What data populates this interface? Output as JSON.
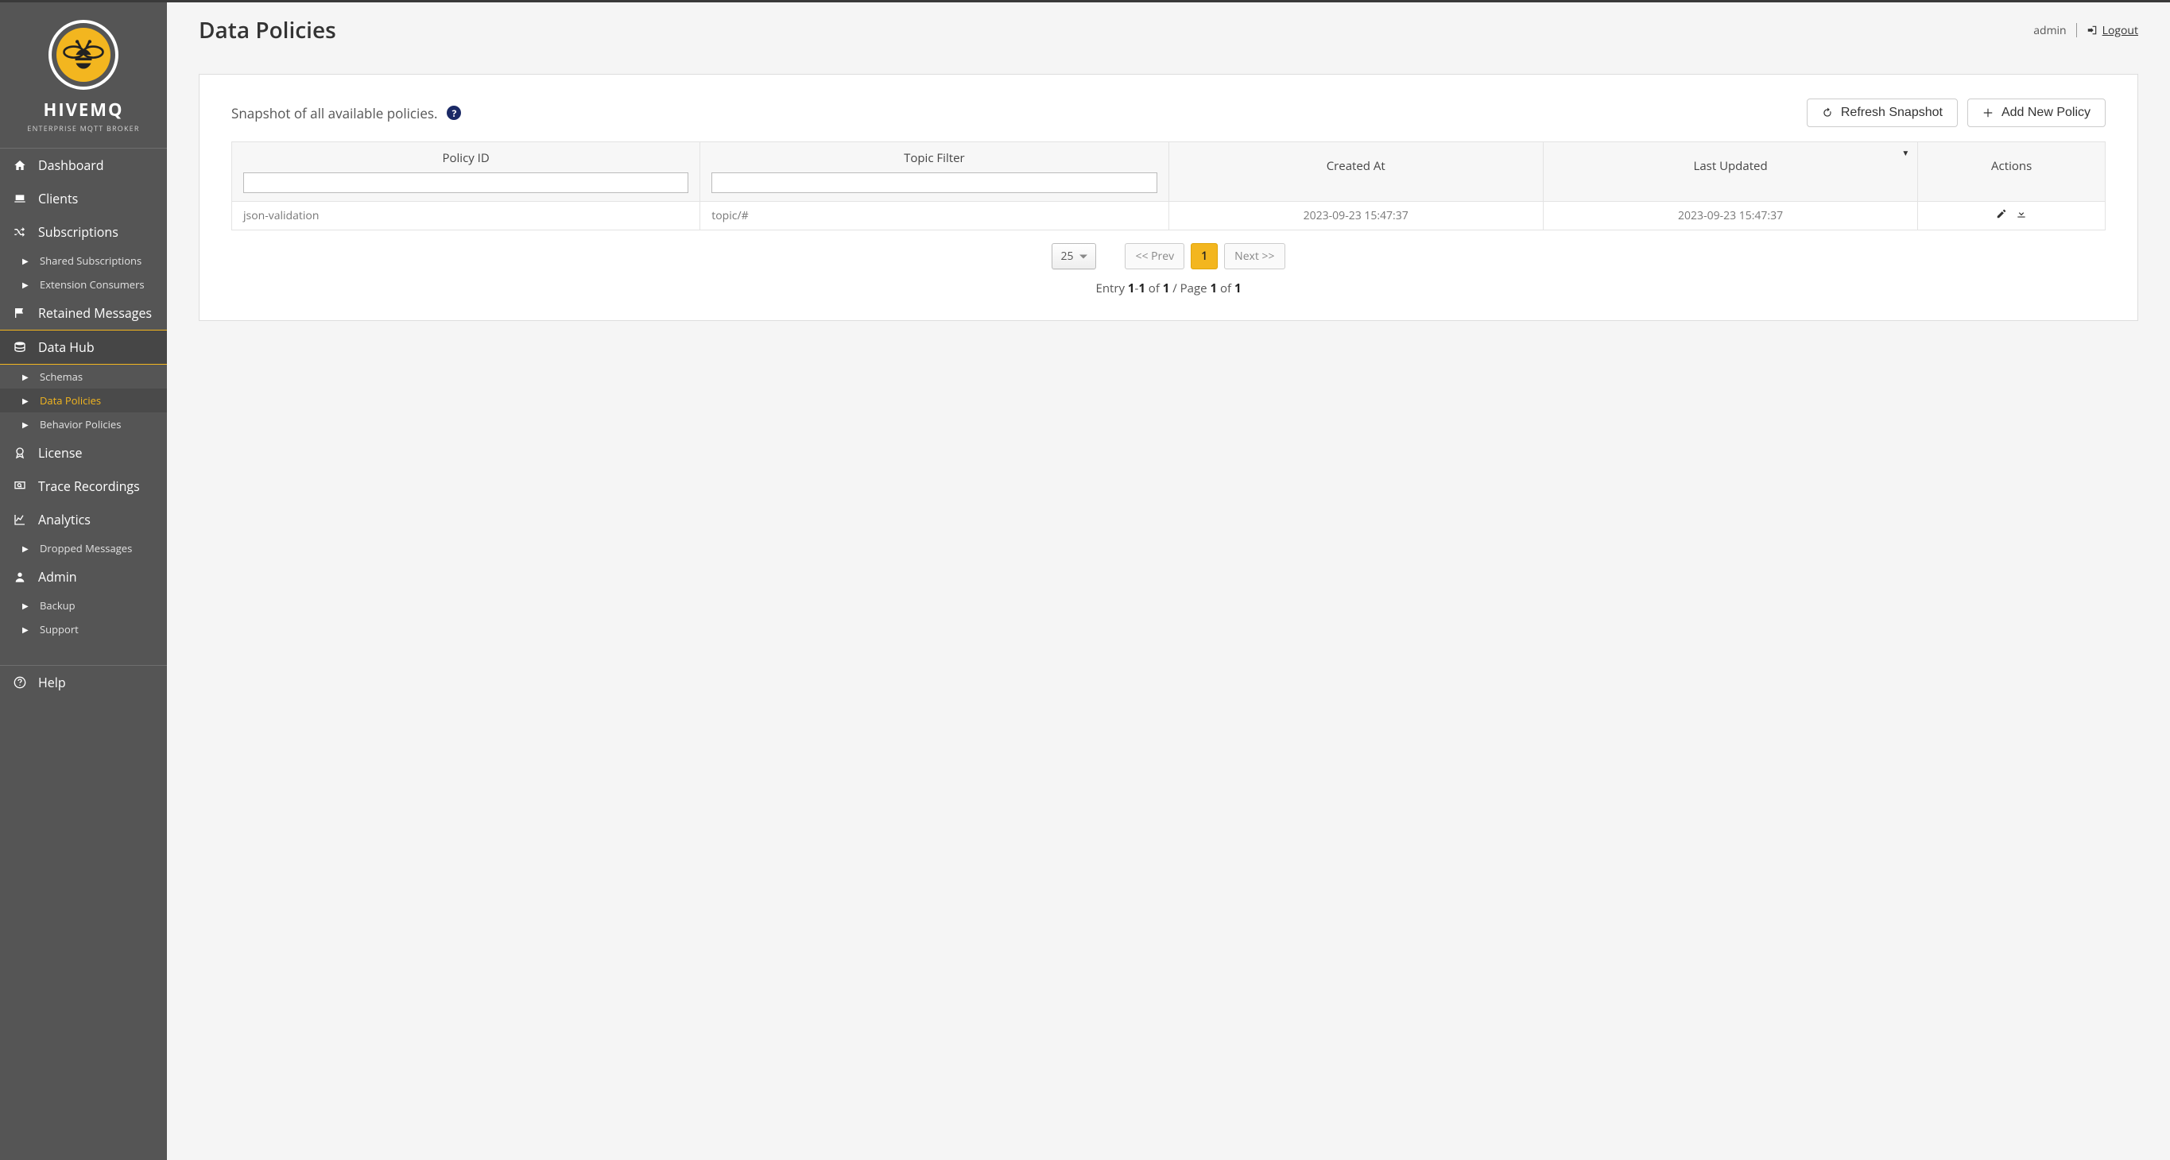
{
  "brand": {
    "name": "HIVEMQ",
    "subtitle": "ENTERPRISE MQTT BROKER"
  },
  "sidebar": {
    "dashboard": "Dashboard",
    "clients": "Clients",
    "subscriptions": "Subscriptions",
    "sub_shared": "Shared Subscriptions",
    "sub_ext": "Extension Consumers",
    "retained": "Retained Messages",
    "datahub": "Data Hub",
    "dh_schemas": "Schemas",
    "dh_data_policies": "Data Policies",
    "dh_behavior": "Behavior Policies",
    "license": "License",
    "trace": "Trace Recordings",
    "analytics": "Analytics",
    "an_dropped": "Dropped Messages",
    "admin": "Admin",
    "ad_backup": "Backup",
    "ad_support": "Support",
    "help": "Help"
  },
  "header": {
    "title": "Data Policies",
    "user": "admin",
    "logout": "Logout"
  },
  "panel": {
    "snapshot_text": "Snapshot of all available policies.",
    "refresh_label": "Refresh Snapshot",
    "add_label": "Add New Policy"
  },
  "table": {
    "col_policy_id": "Policy ID",
    "col_topic_filter": "Topic Filter",
    "col_created": "Created At",
    "col_updated": "Last Updated",
    "col_actions": "Actions",
    "filter_policy_id": "",
    "filter_topic": "",
    "rows": [
      {
        "policy_id": "json-validation",
        "topic_filter": "topic/#",
        "created_at": "2023-09-23 15:47:37",
        "last_updated": "2023-09-23 15:47:37"
      }
    ]
  },
  "pagination": {
    "page_size": "25",
    "prev": "<< Prev",
    "current": "1",
    "next": "Next >>",
    "entry_prefix": "Entry ",
    "entry_from": "1",
    "entry_dash": "-",
    "entry_to": "1",
    "entry_of1": " of ",
    "entry_total": "1",
    "entry_page_sep": " / Page ",
    "entry_page": "1",
    "entry_of2": " of ",
    "entry_pages_total": "1"
  }
}
